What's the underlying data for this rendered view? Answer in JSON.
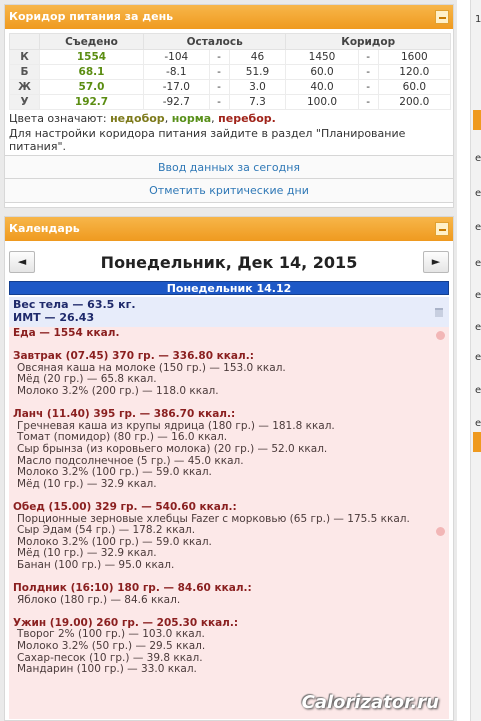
{
  "corridor_panel": {
    "title": "Коридор питания за день",
    "table": {
      "headers": [
        "",
        "Съедено",
        "Осталось",
        "Коридор"
      ],
      "rows": [
        {
          "label": "К",
          "eaten": "1554",
          "left_from": "-104",
          "left_to": "46",
          "corr_from": "1450",
          "corr_to": "1600"
        },
        {
          "label": "Б",
          "eaten": "68.1",
          "left_from": "-8.1",
          "left_to": "51.9",
          "corr_from": "60.0",
          "corr_to": "120.0"
        },
        {
          "label": "Ж",
          "eaten": "57.0",
          "left_from": "-17.0",
          "left_to": "3.0",
          "corr_from": "40.0",
          "corr_to": "60.0"
        },
        {
          "label": "У",
          "eaten": "192.7",
          "left_from": "-92.7",
          "left_to": "7.3",
          "corr_from": "100.0",
          "corr_to": "200.0"
        }
      ],
      "dash": "-"
    },
    "legend_prefix": "Цвета означают:",
    "legend_under": "недобор",
    "legend_norm": "норма",
    "legend_over": "перебор.",
    "sep": ",",
    "settings_note": "Для настройки коридора питания зайдите в раздел \"Планирование питания\".",
    "button_input": "Ввод данных за сегодня",
    "button_critical": "Отметить критические дни"
  },
  "calendar_panel": {
    "title": "Календарь",
    "prev": "◄",
    "next": "►",
    "date_title": "Понедельник, Дек 14, 2015",
    "day_bar": "Понедельник 14.12",
    "weight": "Вес тела — 63.5 кг.",
    "bmi": "ИМТ — 26.43",
    "food_lines": [
      {
        "text": "Еда — 1554 ккал.",
        "type": "meal"
      },
      {
        "text": "",
        "type": "gap"
      },
      {
        "text": "Завтрак (07.45) 370 гр. — 336.80 ккал.:",
        "type": "meal"
      },
      {
        "text": "Овсяная каша на молоке (150 гр.) — 153.0 ккал.",
        "type": "item"
      },
      {
        "text": "Мёд (20 гр.) — 65.8 ккал.",
        "type": "item"
      },
      {
        "text": "Молоко 3.2% (200 гр.) — 118.0 ккал.",
        "type": "item"
      },
      {
        "text": "",
        "type": "gap"
      },
      {
        "text": "Ланч (11.40) 395 гр. — 386.70 ккал.:",
        "type": "meal"
      },
      {
        "text": "Гречневая каша из крупы ядрица (180 гр.) — 181.8 ккал.",
        "type": "item"
      },
      {
        "text": "Томат (помидор) (80 гр.) — 16.0 ккал.",
        "type": "item"
      },
      {
        "text": "Сыр брынза (из коровьего молока) (20 гр.) — 52.0 ккал.",
        "type": "item"
      },
      {
        "text": "Масло подсолнечное (5 гр.) — 45.0 ккал.",
        "type": "item"
      },
      {
        "text": "Молоко 3.2% (100 гр.) — 59.0 ккал.",
        "type": "item"
      },
      {
        "text": "Мёд (10 гр.) — 32.9 ккал.",
        "type": "item"
      },
      {
        "text": "",
        "type": "gap"
      },
      {
        "text": "Обед (15.00) 329 гр. — 540.60 ккал.:",
        "type": "meal"
      },
      {
        "text": "Порционные зерновые хлебцы Fazer с морковью (65 гр.) — 175.5 ккал.",
        "type": "item"
      },
      {
        "text": "Сыр Эдам (54 гр.) — 178.2 ккал.",
        "type": "item"
      },
      {
        "text": "Молоко 3.2% (100 гр.) — 59.0 ккал.",
        "type": "item"
      },
      {
        "text": "Мёд (10 гр.) — 32.9 ккал.",
        "type": "item"
      },
      {
        "text": "Банан (100 гр.) — 95.0 ккал.",
        "type": "item"
      },
      {
        "text": "",
        "type": "gap"
      },
      {
        "text": "Полдник (16:10) 180 гр. — 84.60 ккал.:",
        "type": "meal"
      },
      {
        "text": "Яблоко (180 гр.) — 84.6 ккал.",
        "type": "item"
      },
      {
        "text": "",
        "type": "gap"
      },
      {
        "text": "Ужин (19.00) 260 гр. — 205.30 ккал.:",
        "type": "meal"
      },
      {
        "text": "Творог 2% (100 гр.) — 103.0 ккал.",
        "type": "item"
      },
      {
        "text": "Молоко 3.2% (50 гр.) — 29.5 ккал.",
        "type": "item"
      },
      {
        "text": "Сахар-песок (10 гр.) — 39.8 ккал.",
        "type": "item"
      },
      {
        "text": "Мандарин (100 гр.) — 33.0 ккал.",
        "type": "item"
      }
    ]
  },
  "right_strip": {
    "letters": [
      "1",
      "е",
      "е",
      "е",
      "е",
      "е",
      "е",
      "е",
      "е",
      "е"
    ]
  },
  "watermark": "Calorizator.ru"
}
